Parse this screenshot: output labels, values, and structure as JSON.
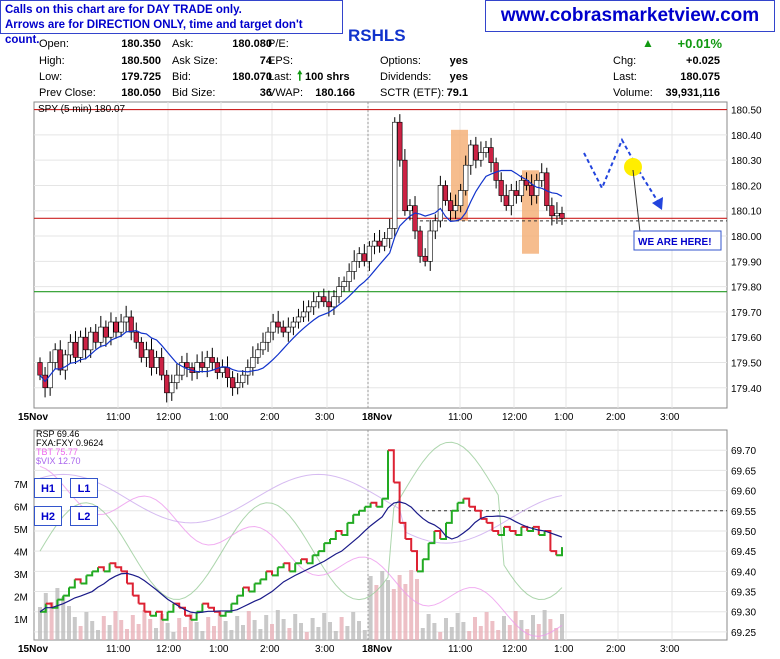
{
  "notice": {
    "line1": "Calls on this chart are for DAY TRADE only.",
    "line2": "Arrows are for DIRECTION ONLY, time and target don't count."
  },
  "website": "www.cobrasmarketview.com",
  "symbol": "RSHLS",
  "quote": {
    "open_label": "Open:",
    "open": "180.350",
    "high_label": "High:",
    "high": "180.500",
    "low_label": "Low:",
    "low": "179.725",
    "prev_label": "Prev Close:",
    "prev": "180.050",
    "ask_label": "Ask:",
    "ask": "180.080",
    "asksize_label": "Ask Size:",
    "asksize": "74",
    "bid_label": "Bid:",
    "bid": "180.070",
    "bidsize_label": "Bid Size:",
    "bidsize": "36",
    "pe_label": "P/E:",
    "eps_label": "EPS:",
    "last_label": "Last:",
    "last_shares": "100 shrs",
    "vwap_label": "VWAP:",
    "vwap": "180.166",
    "options_label": "Options:",
    "options": "yes",
    "dividends_label": "Dividends:",
    "dividends": "yes",
    "sctr_label": "SCTR (ETF):",
    "sctr": "79.1",
    "chg_pct": "+0.01%",
    "chg_label": "Chg:",
    "chg": "+0.025",
    "last2_label": "Last:",
    "last2": "180.075",
    "volume_label": "Volume:",
    "volume": "39,931,116"
  },
  "annotation": {
    "here": "WE ARE HERE!"
  },
  "box_labels": [
    "H1",
    "L1",
    "H2",
    "L2"
  ],
  "colors": {
    "up": "#ffffff",
    "down": "#cc2244",
    "accent": "#1133cc",
    "highlight": "#f5b27a",
    "hline_red": "#cc2222",
    "hline_green": "#229922",
    "arrow": "#2244dd",
    "circle": "#ffee00"
  },
  "chart_data": [
    {
      "type": "candlestick",
      "legend": "SPY (5 min) 180.07",
      "x_ticks": [
        "15Nov",
        "11:00",
        "12:00",
        "1:00",
        "2:00",
        "3:00",
        "18Nov",
        "11:00",
        "12:00",
        "1:00",
        "2:00",
        "3:00"
      ],
      "y_ticks": [
        "180.50",
        "180.40",
        "180.30",
        "180.20",
        "180.10",
        "180.00",
        "179.90",
        "179.80",
        "179.70",
        "179.60",
        "179.50",
        "179.40"
      ],
      "ylim": [
        179.32,
        180.53
      ],
      "horizontal_lines": [
        180.5,
        180.07,
        179.78
      ],
      "close": [
        179.45,
        179.4,
        179.5,
        179.55,
        179.47,
        179.53,
        179.58,
        179.52,
        179.6,
        179.55,
        179.62,
        179.58,
        179.64,
        179.6,
        179.66,
        179.62,
        179.66,
        179.68,
        179.62,
        179.58,
        179.52,
        179.55,
        179.48,
        179.52,
        179.45,
        179.38,
        179.42,
        179.45,
        179.5,
        179.48,
        179.46,
        179.5,
        179.48,
        179.52,
        179.5,
        179.46,
        179.48,
        179.44,
        179.4,
        179.42,
        179.45,
        179.48,
        179.52,
        179.55,
        179.58,
        179.62,
        179.66,
        179.64,
        179.62,
        179.64,
        179.66,
        179.68,
        179.7,
        179.72,
        179.74,
        179.76,
        179.74,
        179.72,
        179.76,
        179.8,
        179.82,
        179.86,
        179.9,
        179.93,
        179.9,
        179.96,
        179.98,
        179.96,
        179.99,
        180.03,
        180.45,
        180.3,
        180.1,
        180.12,
        180.02,
        179.92,
        179.9,
        180.02,
        180.06,
        180.2,
        180.14,
        180.1,
        180.12,
        180.18,
        180.28,
        180.36,
        180.3,
        180.33,
        180.35,
        180.29,
        180.22,
        180.16,
        180.12,
        180.18,
        180.16,
        180.22,
        180.2,
        180.16,
        180.22,
        180.25,
        180.12,
        180.08,
        180.09,
        180.07
      ],
      "vwap_label": "VWAP line (blue)"
    },
    {
      "type": "line",
      "legend": [
        "RSP 69.46",
        "FXA:FXY 0.9624",
        "TBT 75.77",
        "$VIX 12.70"
      ],
      "series_colors": [
        "#2222aa",
        "#33aa33",
        "#ee66ee",
        "#aa66ee"
      ],
      "x_ticks": [
        "15Nov",
        "11:00",
        "12:00",
        "1:00",
        "2:00",
        "3:00",
        "18Nov",
        "11:00",
        "12:00",
        "1:00",
        "2:00",
        "3:00"
      ],
      "y_ticks": [
        "69.70",
        "69.65",
        "69.60",
        "69.55",
        "69.50",
        "69.45",
        "69.40",
        "69.35",
        "69.30",
        "69.25"
      ],
      "volume_ticks": [
        "7M",
        "6M",
        "5M",
        "4M",
        "3M",
        "2M",
        "1M"
      ],
      "ylim": [
        69.23,
        69.75
      ],
      "horizontal_lines": [
        69.55
      ],
      "rsp": [
        69.3,
        69.32,
        69.31,
        69.33,
        69.34,
        69.36,
        69.38,
        69.37,
        69.39,
        69.4,
        69.41,
        69.4,
        69.42,
        69.41,
        69.4,
        69.37,
        69.34,
        69.32,
        69.3,
        69.29,
        69.3,
        69.28,
        69.3,
        69.32,
        69.31,
        69.29,
        69.28,
        69.3,
        69.32,
        69.31,
        69.3,
        69.29,
        69.3,
        69.32,
        69.34,
        69.36,
        69.35,
        69.37,
        69.38,
        69.4,
        69.39,
        69.41,
        69.42,
        69.4,
        69.42,
        69.43,
        69.42,
        69.44,
        69.45,
        69.47,
        69.48,
        69.5,
        69.49,
        69.52,
        69.54,
        69.55,
        69.56,
        69.57,
        69.56,
        69.58,
        69.7,
        69.62,
        69.52,
        69.48,
        69.45,
        69.4,
        69.43,
        69.47,
        69.5,
        69.48,
        69.52,
        69.55,
        69.57,
        69.58,
        69.56,
        69.55,
        69.53,
        69.52,
        69.5,
        69.49,
        69.51,
        69.5,
        69.49,
        69.51,
        69.5,
        69.51,
        69.49,
        69.5,
        69.45,
        69.44,
        69.46
      ]
    }
  ]
}
